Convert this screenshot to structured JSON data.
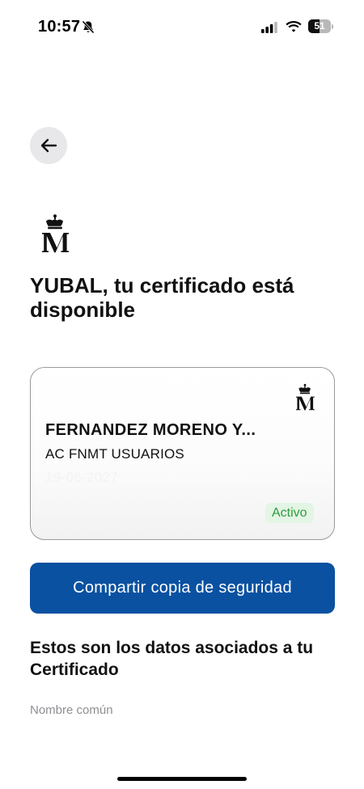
{
  "status_bar": {
    "time": "10:57",
    "battery_level": 51,
    "battery_label": "51",
    "icons": [
      "bell-off-icon",
      "cellular-signal-icon",
      "wifi-icon",
      "battery-icon"
    ]
  },
  "navigation": {
    "back_icon": "arrow-left-icon"
  },
  "header": {
    "logo_icon": "crown-m-logo",
    "title": "YUBAL, tu certificado está disponible"
  },
  "certificate_card": {
    "logo_icon": "crown-m-logo",
    "holder": "FERNANDEZ MORENO Y...",
    "issuer": "AC FNMT USUARIOS",
    "expiry_date": "19-06-2027",
    "status": "Activo"
  },
  "actions": {
    "share_label": "Compartir copia de seguridad"
  },
  "details": {
    "section_title": "Estos son los datos asociados a tu Certificado",
    "fields": [
      {
        "label": "Nombre común"
      }
    ]
  },
  "colors": {
    "primary": "#0a51a1",
    "status_active_bg": "#e3f5e5",
    "status_active_text": "#2e9b3f",
    "back_button_bg": "#e8e8ea",
    "muted_text": "#8e8e93"
  }
}
